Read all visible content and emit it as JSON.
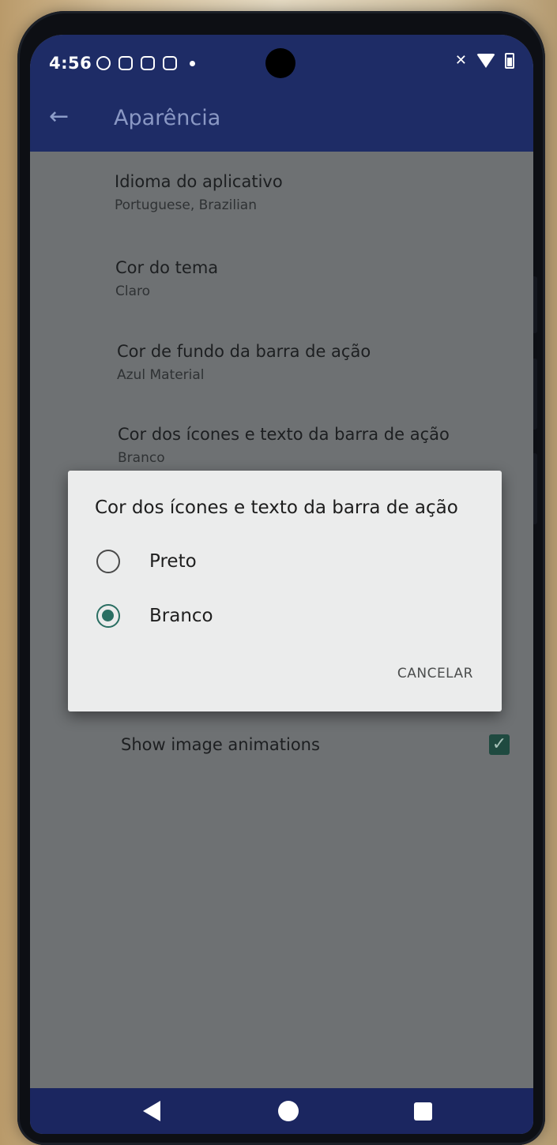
{
  "status_bar": {
    "time": "4:56",
    "left_icons": [
      "sync-icon",
      "sim-card-icon",
      "clipboard-icon",
      "chat-icon"
    ],
    "right_icons": [
      "mute-icon",
      "wifi-icon",
      "battery-icon"
    ]
  },
  "toolbar": {
    "title": "Aparência",
    "back_icon": "arrow-left-icon",
    "background_color": "#1e2c66"
  },
  "preferences": [
    {
      "title": "Idioma do aplicativo",
      "summary": "Portuguese, Brazilian"
    },
    {
      "title": "Cor do tema",
      "summary": "Claro"
    },
    {
      "title": "Cor de fundo da barra de ação",
      "summary": "Azul Material"
    },
    {
      "title": "Cor dos ícones e texto da barra de ação",
      "summary": "Branco"
    }
  ],
  "toggles": [
    {
      "label": "Show image animations",
      "checked": true
    }
  ],
  "dialog": {
    "title": "Cor dos ícones e texto da barra de ação",
    "options": [
      {
        "label": "Preto",
        "selected": false
      },
      {
        "label": "Branco",
        "selected": true
      }
    ],
    "cancel_label": "CANCELAR",
    "accent_color": "#2a6e62"
  },
  "nav_bar": {
    "icons": [
      "nav-back-icon",
      "nav-home-icon",
      "nav-recents-icon"
    ]
  }
}
